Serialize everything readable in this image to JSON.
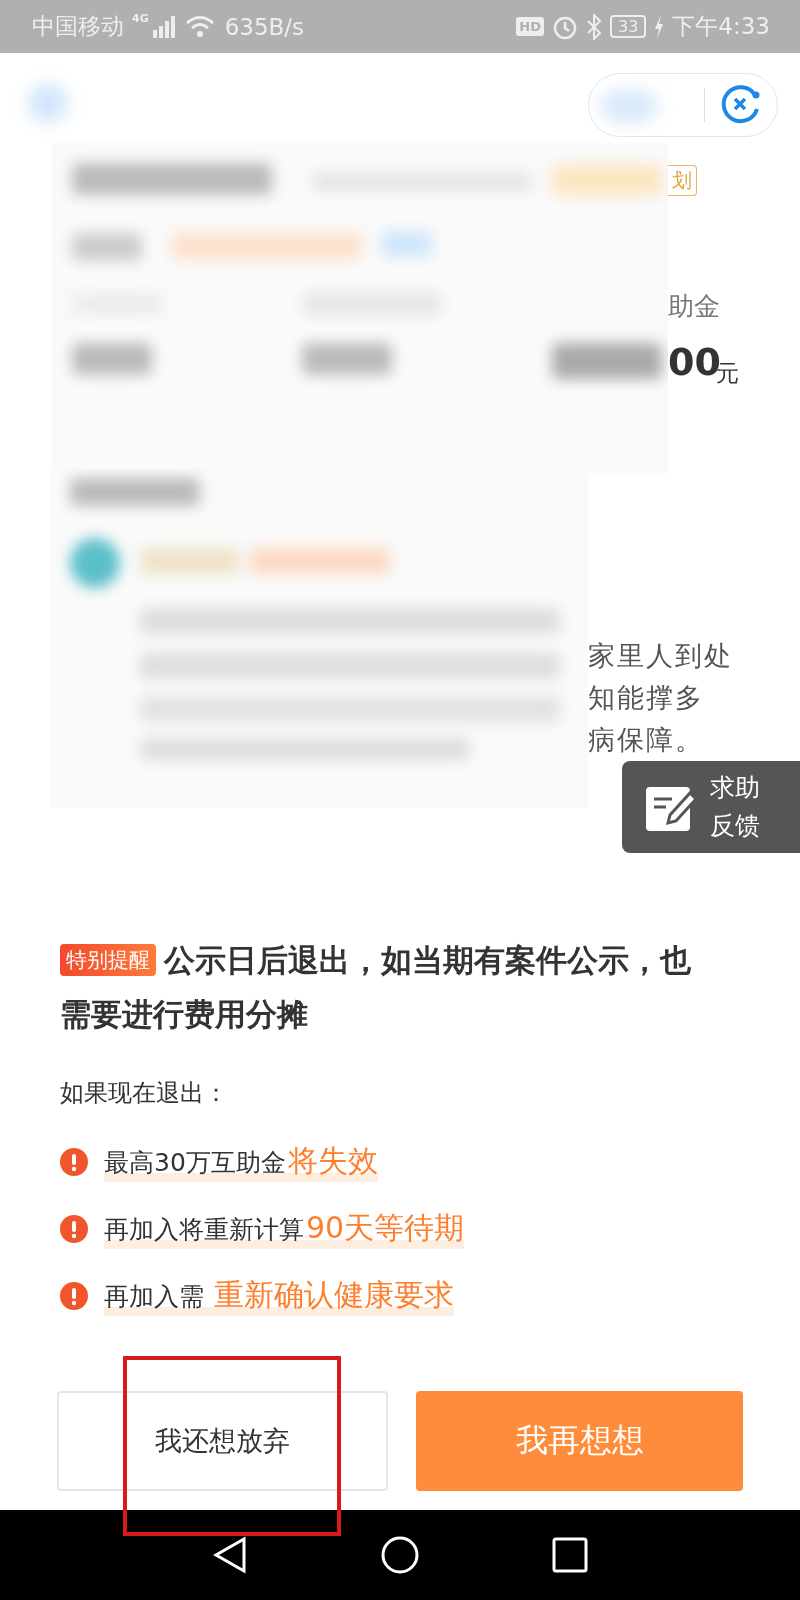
{
  "status_bar": {
    "carrier": "中国移动",
    "network": "4G",
    "speed": "635B/s",
    "hd": "HD",
    "battery": "33",
    "time": "下午4:33"
  },
  "summary_fragments": {
    "tag": "划",
    "label": "助金",
    "amount": "00",
    "unit": "元"
  },
  "story_fragments": [
    "家里人到处",
    "知能撑多",
    "病保障。"
  ],
  "help_button": {
    "lines": [
      "求助",
      "反馈"
    ]
  },
  "notice": {
    "badge": "特别提醒",
    "text": "公示日后退出，如当期有案件公示，也需要进行费用分摊"
  },
  "consequences": {
    "intro": "如果现在退出：",
    "items": [
      {
        "text": "最高30万互助金",
        "highlight": "将失效"
      },
      {
        "text": "再加入将重新计算",
        "highlight": "90天等待期"
      },
      {
        "text": "再加入需 ",
        "highlight": "重新确认健康要求"
      }
    ]
  },
  "buttons": [
    {
      "label": "我还想放弃",
      "kind": "secondary"
    },
    {
      "label": "我再想想",
      "kind": "primary"
    }
  ]
}
